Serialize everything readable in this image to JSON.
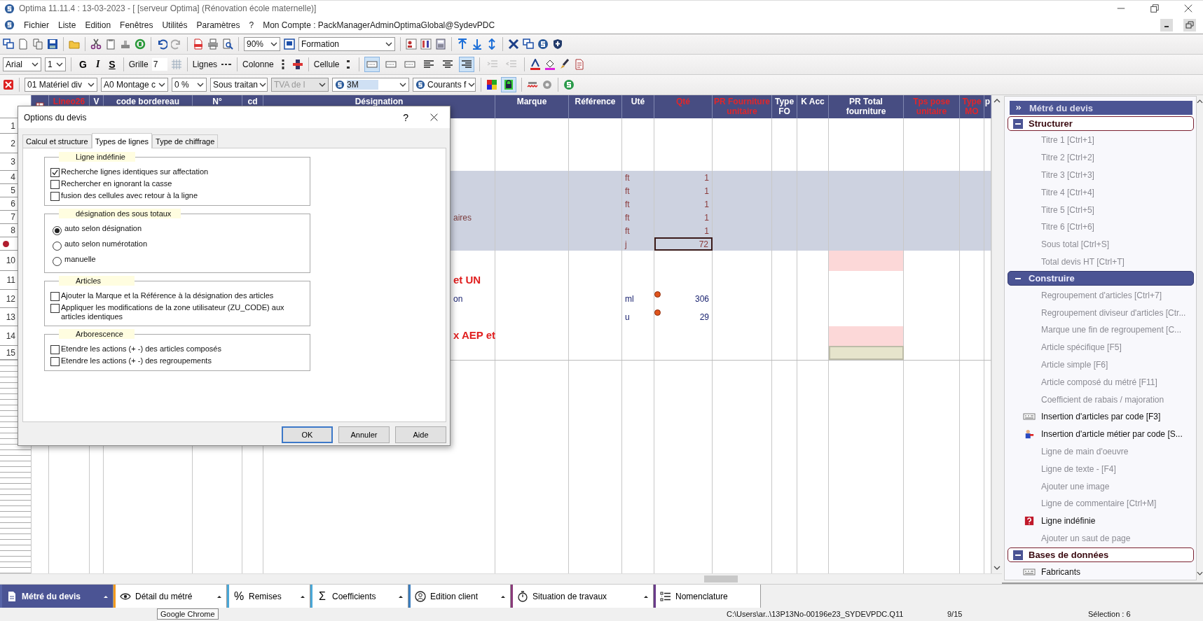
{
  "window": {
    "title": "Optima 11.11.4 : 13-03-2023 - [ [serveur Optima] (Rénovation école maternelle)]"
  },
  "menu": {
    "items": [
      "Fichier",
      "Liste",
      "Edition",
      "Fenêtres",
      "Utilités",
      "Paramètres",
      "?"
    ],
    "account": "Mon Compte : PackManagerAdminOptimaGlobal@SydevPDC"
  },
  "toolbar": {
    "zoom": "90%",
    "profile": "Formation"
  },
  "format_bar": {
    "font": "Arial",
    "size": "1",
    "bold": "G",
    "italic": "I",
    "underline": "S",
    "grid_label": "Grille",
    "grid_value": "7",
    "lines_label": "Lignes",
    "columns_label": "Colonne",
    "cell_label": "Cellule",
    "border_buttons": [
      {
        "selected": true
      },
      {
        "selected": false
      },
      {
        "selected": false
      }
    ],
    "align_buttons": [
      {
        "selected": false
      },
      {
        "selected": false
      },
      {
        "selected": true
      }
    ],
    "indent_buttons": [
      {
        "disabled": true
      },
      {
        "disabled": true
      }
    ]
  },
  "filter_bar": {
    "combos": [
      {
        "value": "01  Matériel div",
        "disabled": false,
        "kind": "plain"
      },
      {
        "value": "A0  Montage c",
        "disabled": false,
        "kind": "plain"
      },
      {
        "value": "0 %",
        "disabled": false,
        "kind": "plain"
      },
      {
        "value": "Sous traitan",
        "disabled": false,
        "kind": "plain"
      },
      {
        "value": "TVA de l",
        "disabled": true,
        "kind": "plain"
      },
      {
        "value": "3M",
        "disabled": false,
        "kind": "logo"
      },
      {
        "value": "Courants f",
        "disabled": false,
        "kind": "logo"
      }
    ],
    "lock": {
      "selected": true
    }
  },
  "grid": {
    "columns": [
      {
        "label": "Lineo26",
        "highlighted": true
      },
      {
        "label": "V",
        "highlighted": false
      },
      {
        "label": "code bordereau",
        "highlighted": false
      },
      {
        "label": "N°",
        "highlighted": false
      },
      {
        "label": "cd",
        "highlighted": false
      },
      {
        "label": "Désignation",
        "highlighted": false
      },
      {
        "label": "Marque",
        "highlighted": false
      },
      {
        "label": "Référence",
        "highlighted": false
      },
      {
        "label": "Uté",
        "highlighted": false
      },
      {
        "label": "Qté",
        "highlighted": true
      },
      {
        "label": "PR Fourniture unitaire",
        "highlighted": true
      },
      {
        "label": "Type FO",
        "highlighted": false
      },
      {
        "label": "K Acc",
        "highlighted": false
      },
      {
        "label": "PR Total fourniture",
        "highlighted": false
      },
      {
        "label": "Tps pose unitaire",
        "highlighted": true
      },
      {
        "label": "Type MO",
        "highlighted": true
      },
      {
        "label": "p",
        "highlighted": false
      }
    ],
    "rows": [
      {
        "number": "1",
        "band": false,
        "current": false
      },
      {
        "number": "2",
        "band": false,
        "current": false
      },
      {
        "number": "3",
        "band": false,
        "current": false
      },
      {
        "number": "4",
        "band": true,
        "current": false,
        "unit": "ft",
        "qty": "1"
      },
      {
        "number": "5",
        "band": true,
        "current": false,
        "unit": "ft",
        "qty": "1"
      },
      {
        "number": "6",
        "band": true,
        "current": false,
        "unit": "ft",
        "qty": "1"
      },
      {
        "number": "7",
        "band": true,
        "current": false,
        "unit": "ft",
        "qty": "1",
        "designation": "aires",
        "kind": "band"
      },
      {
        "number": "8",
        "band": true,
        "current": false,
        "unit": "ft",
        "qty": "1"
      },
      {
        "band": true,
        "current": true,
        "unit": "j",
        "qty": "72",
        "focused": true
      },
      {
        "number": "10",
        "band": false,
        "current": false,
        "total_flagged": true
      },
      {
        "number": "11",
        "band": false,
        "current": false,
        "designation": "et UN",
        "kind": "title"
      },
      {
        "number": "12",
        "band": false,
        "current": false,
        "designation": "on",
        "kind": "article",
        "unit": "ml",
        "qty": "306",
        "marker": true
      },
      {
        "number": "13",
        "band": false,
        "current": false,
        "unit": "u",
        "qty": "29",
        "marker": true
      },
      {
        "number": "14",
        "band": false,
        "current": false,
        "designation": "x AEP et",
        "kind": "title",
        "total_flagged": true
      },
      {
        "number": "15",
        "band": false,
        "current": false,
        "total_editing": true
      }
    ]
  },
  "dialog": {
    "title": "Options du devis",
    "help": "?",
    "tabs": [
      {
        "label": "Calcul et structure",
        "selected": false
      },
      {
        "label": "Types de lignes",
        "selected": true
      },
      {
        "label": "Type de chiffrage",
        "selected": false
      }
    ],
    "groups": [
      {
        "legend": "Ligne indéfinie",
        "options": [
          {
            "kind": "checkbox",
            "label": "Recherche lignes identiques sur affectation",
            "checked": true
          },
          {
            "kind": "checkbox",
            "label": "Rechercher en ignorant la casse",
            "checked": false
          },
          {
            "kind": "checkbox",
            "label": "fusion des cellules avec retour à la ligne",
            "checked": false
          }
        ]
      },
      {
        "legend": "désignation des sous totaux",
        "options": [
          {
            "kind": "radio",
            "label": "auto selon désignation",
            "checked": true
          },
          {
            "kind": "radio",
            "label": "auto selon numérotation",
            "checked": false
          },
          {
            "kind": "radio",
            "label": "manuelle",
            "checked": false
          }
        ]
      },
      {
        "legend": "Articles",
        "options": [
          {
            "kind": "checkbox",
            "label": "Ajouter la Marque et la Référence à la désignation des articles",
            "checked": false
          },
          {
            "kind": "checkbox",
            "label": "Appliquer les modifications de la zone utilisateur (ZU_CODE) aux articles identiques",
            "checked": false
          }
        ]
      },
      {
        "legend": "Arborescence",
        "options": [
          {
            "kind": "checkbox",
            "label": "Etendre les actions (+ -) des articles composés",
            "checked": false
          },
          {
            "kind": "checkbox",
            "label": "Etendre les actions (+ -) des regroupements",
            "checked": false
          }
        ]
      }
    ],
    "buttons": [
      {
        "label": "OK",
        "default": true
      },
      {
        "label": "Annuler",
        "default": false
      },
      {
        "label": "Aide",
        "default": false
      }
    ]
  },
  "panel": {
    "title": "Métré du devis",
    "sections": [
      {
        "label": "Structurer",
        "expanded": true,
        "selected": false,
        "items": [
          {
            "label": "Titre 1 [Ctrl+1]",
            "disabled": true,
            "kind": "plain"
          },
          {
            "label": "Titre 2 [Ctrl+2]",
            "disabled": true,
            "kind": "plain"
          },
          {
            "label": "Titre 3 [Ctrl+3]",
            "disabled": true,
            "kind": "plain"
          },
          {
            "label": "Titre 4 [Ctrl+4]",
            "disabled": true,
            "kind": "plain"
          },
          {
            "label": "Titre 5 [Ctrl+5]",
            "disabled": true,
            "kind": "plain"
          },
          {
            "label": "Titre 6 [Ctrl+6]",
            "disabled": true,
            "kind": "plain"
          },
          {
            "label": "Sous total [Ctrl+S]",
            "disabled": true,
            "kind": "plain"
          },
          {
            "label": "Total devis HT [Ctrl+T]",
            "disabled": true,
            "kind": "plain"
          }
        ]
      },
      {
        "label": "Construire",
        "expanded": true,
        "selected": true,
        "items": [
          {
            "label": "Regroupement d'articles  [Ctrl+7]",
            "disabled": true,
            "kind": "plain"
          },
          {
            "label": "Regroupement diviseur d'articles [Ctr...",
            "disabled": true,
            "kind": "plain"
          },
          {
            "label": "Marque une fin de regroupement  [C...",
            "disabled": true,
            "kind": "plain"
          },
          {
            "label": "Article spécifique [F5]",
            "disabled": true,
            "kind": "plain"
          },
          {
            "label": "Article simple [F6]",
            "disabled": true,
            "kind": "plain"
          },
          {
            "label": "Article composé du métré [F11]",
            "disabled": true,
            "kind": "plain"
          },
          {
            "label": "Coefficient de rabais / majoration",
            "disabled": true,
            "kind": "plain"
          },
          {
            "label": "Insertion d'articles par code [F3]",
            "disabled": false,
            "kind": "code"
          },
          {
            "label": "Insertion d'article métier par code [S...",
            "disabled": false,
            "kind": "worker"
          },
          {
            "label": "Ligne de main d'oeuvre",
            "disabled": true,
            "kind": "plain"
          },
          {
            "label": "Ligne de texte - [F4]",
            "disabled": true,
            "kind": "plain"
          },
          {
            "label": "Ajouter une image",
            "disabled": true,
            "kind": "plain"
          },
          {
            "label": "Ligne de commentaire [Ctrl+M]",
            "disabled": true,
            "kind": "plain"
          },
          {
            "label": "Ligne indéfinie",
            "disabled": false,
            "kind": "unknown"
          },
          {
            "label": "Ajouter un saut de page",
            "disabled": true,
            "kind": "plain"
          }
        ]
      },
      {
        "label": "Bases de données",
        "expanded": true,
        "selected": false,
        "items": [
          {
            "label": "Fabricants",
            "disabled": false,
            "kind": "code"
          }
        ]
      }
    ]
  },
  "bottom_tabs": [
    {
      "label": "Métré du devis",
      "selected": true,
      "color": "#5865a8",
      "kind": "document",
      "menu": true
    },
    {
      "label": "Détail du métré",
      "selected": false,
      "color": "#f39a1e",
      "kind": "eye",
      "menu": true
    },
    {
      "label": "Remises",
      "selected": false,
      "color": "#4aa8d8",
      "kind": "glyph",
      "symbol": "%",
      "menu": true
    },
    {
      "label": "Coefficients",
      "selected": false,
      "color": "#4aa8d8",
      "kind": "glyph",
      "symbol": "Σ",
      "menu": true
    },
    {
      "label": "Edition client",
      "selected": false,
      "color": "#3c7fc0",
      "kind": "person",
      "menu": true
    },
    {
      "label": "Situation de travaux",
      "selected": false,
      "color": "#8a3a7a",
      "kind": "stopwatch",
      "menu": true
    },
    {
      "label": "Nomenclature",
      "selected": false,
      "color": "#6a3a8a",
      "kind": "list",
      "menu": false
    }
  ],
  "status_bar": {
    "tooltip": "Google Chrome",
    "path": "C:\\Users\\ar..\\13P13No-00196e23_SYDEVPDC.Q11",
    "page": "9/15",
    "selection": "Sélection : 6"
  }
}
